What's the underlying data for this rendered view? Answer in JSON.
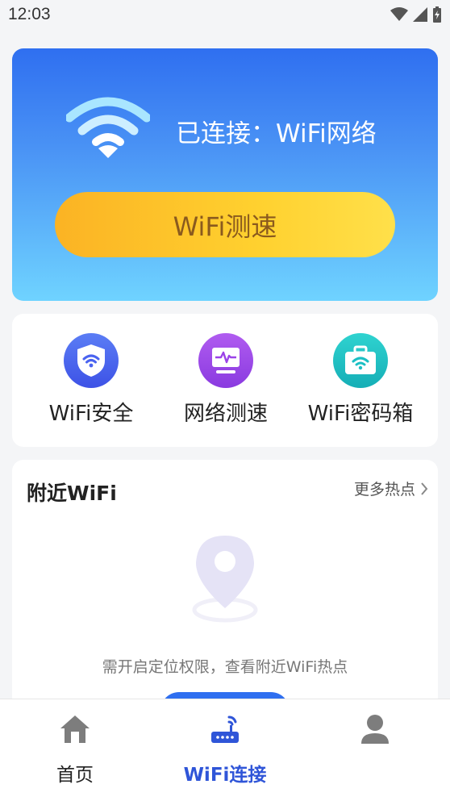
{
  "status_bar": {
    "time": "12:03"
  },
  "hero": {
    "connected_text": "已连接：WiFi网络",
    "speed_test_button": "WiFi测速"
  },
  "tools": [
    {
      "label": "WiFi安全",
      "icon": "shield-wifi-icon",
      "color": "#4a63f0"
    },
    {
      "label": "网络测速",
      "icon": "monitor-pulse-icon",
      "color": "#9b43e8"
    },
    {
      "label": "WiFi密码箱",
      "icon": "case-wifi-icon",
      "color": "#1bbfc4"
    }
  ],
  "nearby": {
    "title": "附近WiFi",
    "more_link": "更多热点",
    "hint": "需开启定位权限，查看附近WiFi热点",
    "pin_icon": "location-pin-icon"
  },
  "tabbar": {
    "items": [
      {
        "label": "首页",
        "icon": "home-icon",
        "active": false
      },
      {
        "label": "WiFi连接",
        "icon": "router-icon",
        "active": true
      },
      {
        "label": "",
        "icon": "user-icon",
        "active": false
      }
    ],
    "active_color": "#2f55d8"
  }
}
